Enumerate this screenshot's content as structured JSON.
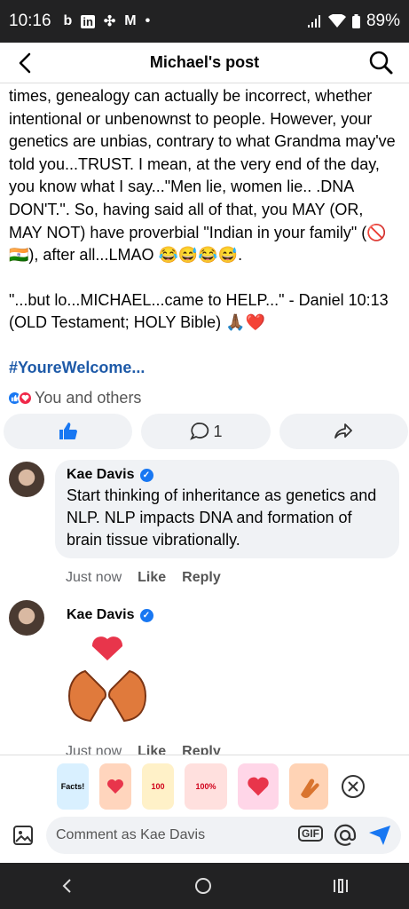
{
  "status": {
    "time": "10:16",
    "battery": "89%",
    "apps": [
      "b",
      "in",
      "✣",
      "M",
      "•"
    ]
  },
  "app_bar": {
    "title": "Michael's post"
  },
  "post": {
    "paragraph1": "times, genealogy can actually be incorrect, whether intentional or unbenownst to people. However, your genetics are unbias, contrary to what Grandma may've told you...TRUST.  I mean, at the very end of the day, you know what I say...\"Men lie, women lie.. .DNA DON'T.\".  So, having said all of that, you MAY (OR, MAY NOT) have proverbial \"Indian in your family\" (🚫🇮🇳), after all...LMAO 😂😅😂😅.",
    "paragraph2": "\"...but lo...MICHAEL...came to HELP...\" - Daniel 10:13 (OLD Testament; HOLY Bible)  🙏🏾❤️",
    "hashtag": "#YoureWelcome...",
    "reactions_text": "You and others",
    "comment_count": "1"
  },
  "comments": [
    {
      "author": "Kae Davis",
      "text": "Start thinking of inheritance as genetics and NLP. NLP impacts DNA and formation of brain tissue vibrationally.",
      "time": "Just now",
      "like": "Like",
      "reply": "Reply"
    },
    {
      "author": "Kae Davis",
      "time": "Just now",
      "like": "Like",
      "reply": "Reply"
    }
  ],
  "stickers": [
    {
      "label": "Facts!",
      "color": "#d9f0ff"
    },
    {
      "label": "",
      "color": "#ffd5bd"
    },
    {
      "label": "100",
      "color": "#fff1c8"
    },
    {
      "label": "100%",
      "color": "#ffe0de"
    },
    {
      "label": "",
      "color": "#ffd6e8"
    },
    {
      "label": "",
      "color": "#ffd3b5"
    }
  ],
  "input": {
    "placeholder": "Comment as Kae Davis",
    "gif_label": "GIF"
  },
  "colors": {
    "accent": "#1877f2",
    "hashtag": "#1e5aa8",
    "bubble": "#f0f2f5"
  }
}
